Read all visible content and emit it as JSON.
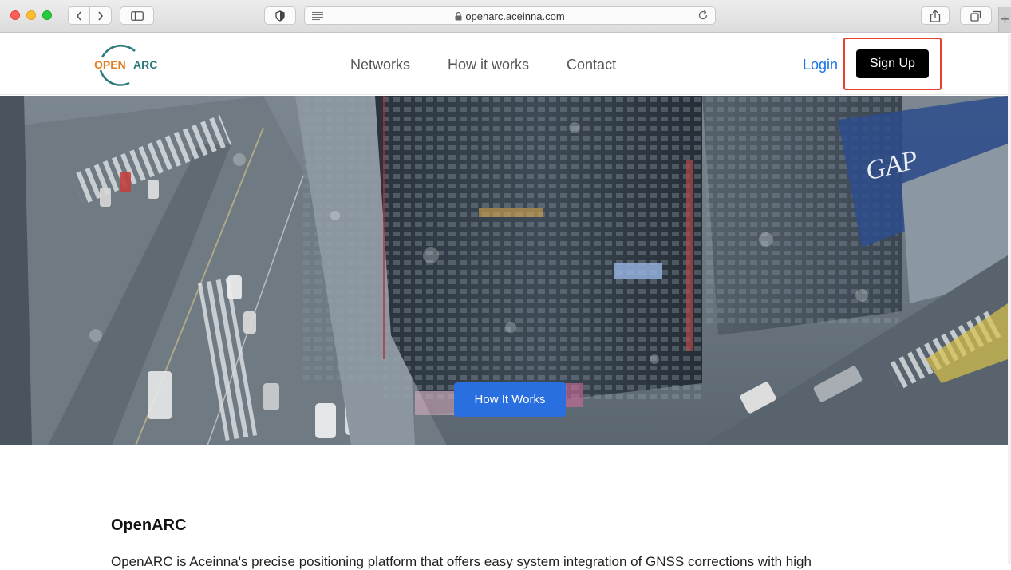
{
  "browser": {
    "url": "openarc.aceinna.com"
  },
  "header": {
    "logo_text_left": "OPEN",
    "logo_text_right": "ARC",
    "nav": [
      {
        "label": "Networks"
      },
      {
        "label": "How it works"
      },
      {
        "label": "Contact"
      }
    ],
    "login_label": "Login",
    "signup_label": "Sign Up"
  },
  "hero": {
    "cta_label": "How It Works"
  },
  "section": {
    "title": "OpenARC",
    "body": "OpenARC is Aceinna's precise positioning platform that offers easy system integration of GNSS corrections with high"
  },
  "colors": {
    "accent_blue": "#2a6fe0",
    "link_blue": "#1a73e8",
    "logo_orange": "#e07b1f",
    "logo_teal": "#2c7a7b",
    "highlight_red": "#e8412f"
  }
}
